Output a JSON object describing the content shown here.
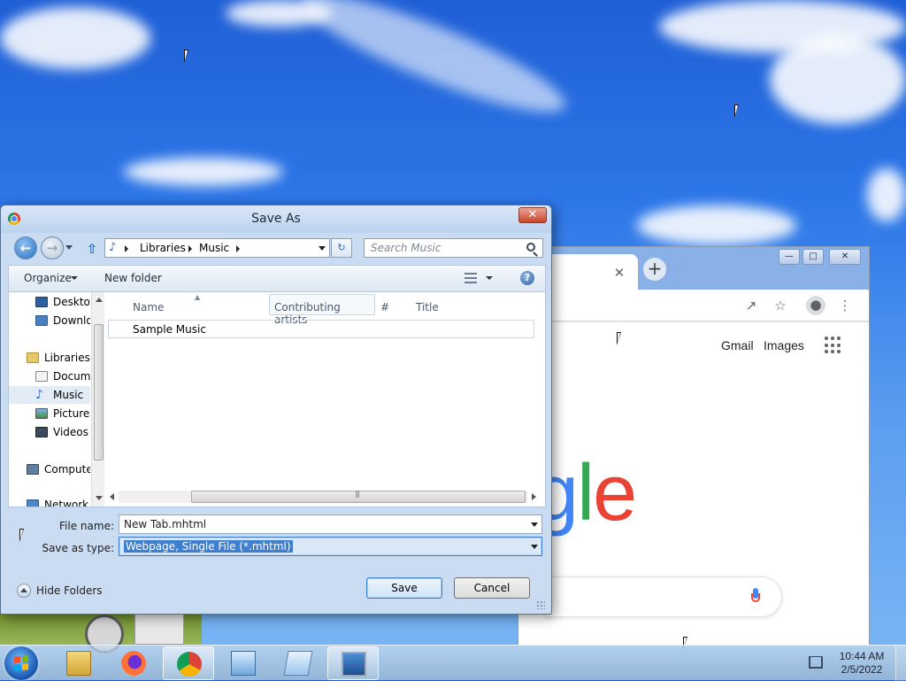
{
  "dialog": {
    "title": "Save As",
    "close_label": "✕",
    "breadcrumb": [
      "Libraries",
      "Music"
    ],
    "search_placeholder": "Search Music",
    "organize_label": "Organize",
    "new_folder_label": "New folder",
    "nav_items": [
      {
        "label": "Desktop",
        "icon": "desktop-icon"
      },
      {
        "label": "Downloads",
        "icon": "downloads-icon"
      },
      {
        "label": "Libraries",
        "icon": "libraries-icon"
      },
      {
        "label": "Documents",
        "icon": "documents-icon"
      },
      {
        "label": "Music",
        "icon": "music-icon",
        "selected": true
      },
      {
        "label": "Pictures",
        "icon": "pictures-icon"
      },
      {
        "label": "Videos",
        "icon": "videos-icon"
      },
      {
        "label": "Computer",
        "icon": "computer-icon"
      },
      {
        "label": "Network",
        "icon": "network-icon"
      }
    ],
    "columns": [
      "Name",
      "Contributing artists",
      "#",
      "Title"
    ],
    "files": [
      "Sample Music"
    ],
    "file_name_label": "File name:",
    "file_name_value": "New Tab.mhtml",
    "save_type_label": "Save as type:",
    "save_type_value": "Webpage, Single File (*.mhtml)",
    "hide_folders_label": "Hide Folders",
    "save_label": "Save",
    "cancel_label": "Cancel"
  },
  "browser": {
    "tab_close": "✕",
    "new_tab": "+",
    "links": [
      "Gmail",
      "Images"
    ],
    "logo_letters": [
      "g",
      "l",
      "e"
    ],
    "logo_colors": [
      "#4285f4",
      "#34a853",
      "#ea4335"
    ]
  },
  "taskbar": {
    "time": "10:44 AM",
    "date": "2/5/2022",
    "apps": [
      "explorer",
      "firefox",
      "chrome",
      "control-panel",
      "notepad",
      "remote-desktop"
    ]
  }
}
